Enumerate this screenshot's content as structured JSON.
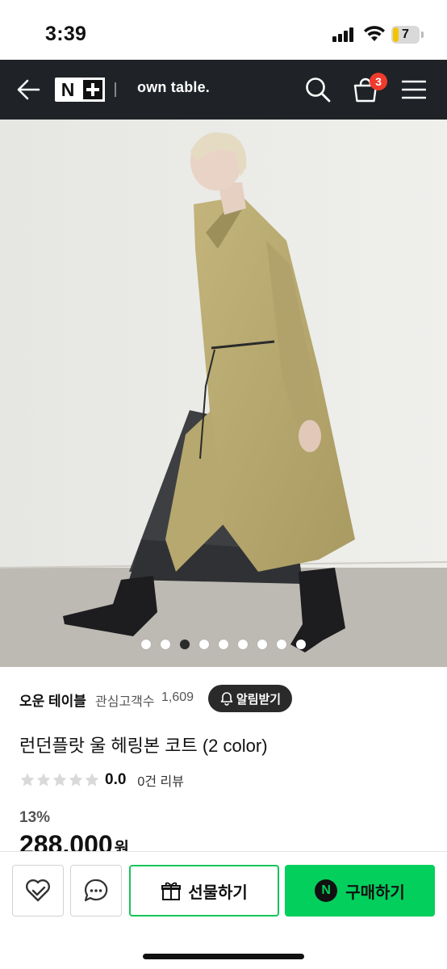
{
  "status_bar": {
    "time": "3:39",
    "battery": "7"
  },
  "header": {
    "logo_n": "N",
    "brand": "own table.",
    "cart_count": "3",
    "icons": [
      "back-arrow-icon",
      "search-icon",
      "cart-icon",
      "menu-icon"
    ]
  },
  "gallery": {
    "total_images": 9,
    "active_index": 2
  },
  "store": {
    "name": "오운 테이블",
    "followers_label": "관심고객수",
    "followers_count": "1,609",
    "alert_label": "알림받기"
  },
  "product": {
    "title": "런던플랏 울 헤링본 코트 (2 color)",
    "rating": "0.0",
    "rating_stars": 0,
    "review_count": "0건 리뷰",
    "discount": "13%",
    "price": "288,000",
    "price_unit": "원"
  },
  "bottom_bar": {
    "gift_label": "선물하기",
    "buy_label": "구매하기",
    "npay_mark": "N"
  },
  "colors": {
    "header_bg": "#1f2327",
    "badge": "#ef3b2d",
    "naver_green": "#03cf5d"
  }
}
